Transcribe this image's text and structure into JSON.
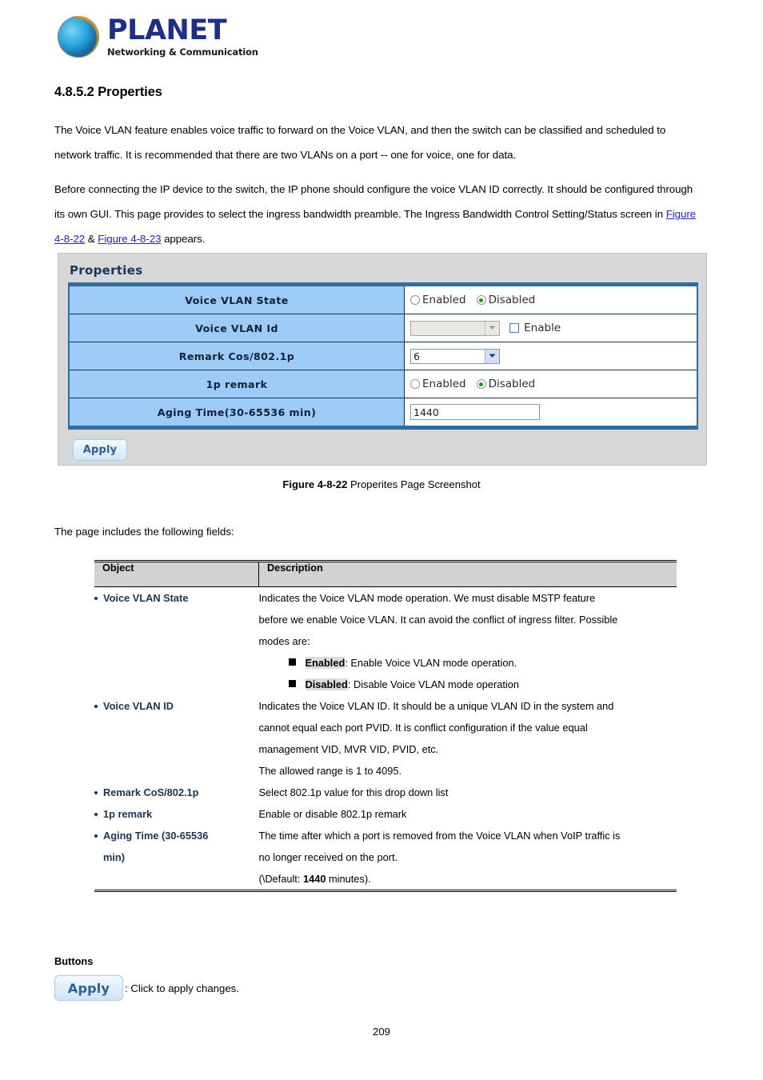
{
  "brand": {
    "name": "PLANET",
    "tagline": "Networking & Communication",
    "logo_icon": "globe-icon"
  },
  "document": {
    "section_number": "4.8.5.2",
    "section_title": "4.8.5.2 Properties",
    "paragraph_1": "The Voice VLAN feature enables voice traffic to forward on the Voice VLAN, and then the switch can be classified and scheduled to network traffic. It is recommended that there are two VLANs on a port -- one for voice, one for data.",
    "paragraph_2_part_1": "Before connecting the IP device to the switch, the IP phone should configure the voice VLAN ID correctly. It should be configured through its own GUI. This page provides to select the ingress bandwidth preamble. The Ingress Bandwidth Control Setting/Status screen in ",
    "link_1": "Figure 4-8-22",
    "paragraph_2_amp": " & ",
    "link_2": "Figure 4-8-23",
    "paragraph_2_part_2": " appears.",
    "figure_caption_bold": "Figure 4-8-22",
    "figure_caption_rest": " Properites Page Screenshot",
    "fields_intro": "The page includes the following fields:",
    "page_number": "209",
    "link_color": "#2222dd"
  },
  "screenshot": {
    "title": "Properties",
    "rows": [
      {
        "label": "Voice VLAN State",
        "control": "radio",
        "options": [
          "Enabled",
          "Disabled"
        ],
        "selected": "Disabled"
      },
      {
        "label": "Voice VLAN Id",
        "control": "select-disabled-with-checkbox",
        "select_value": "",
        "checkbox_label": "Enable",
        "checkbox_checked": false
      },
      {
        "label": "Remark Cos/802.1p",
        "control": "select",
        "select_value": "6"
      },
      {
        "label": "1p remark",
        "control": "radio",
        "options": [
          "Enabled",
          "Disabled"
        ],
        "selected": "Disabled"
      },
      {
        "label": "Aging Time(30-65536 min)",
        "control": "text",
        "value": "1440"
      }
    ],
    "apply_label": "Apply",
    "colors": {
      "panel_bg": "#d7d7d7",
      "label_cell": "#9ccbf5",
      "table_border": "#2e6da4",
      "title_text": "#17365d"
    }
  },
  "desc_table": {
    "headers": [
      "Object",
      "Description"
    ],
    "rows": [
      {
        "object": [
          "Voice VLAN State"
        ],
        "lines": [
          "Indicates the Voice VLAN mode operation. We must disable MSTP feature",
          "before we enable Voice VLAN. It can avoid the conflict of ingress filter. Possible",
          "modes are:"
        ],
        "bullets": [
          {
            "term": "Enabled",
            "text": ": Enable Voice VLAN mode operation."
          },
          {
            "term": "Disabled",
            "text": ": Disable Voice VLAN mode operation"
          }
        ]
      },
      {
        "object": [
          "Voice VLAN ID"
        ],
        "lines": [
          "Indicates the Voice VLAN ID. It should be a unique VLAN ID in the system and",
          "cannot equal each port PVID. It is conflict configuration if the value equal",
          "management VID, MVR VID, PVID, etc.",
          "The allowed range is 1 to 4095."
        ],
        "bullets": []
      },
      {
        "object": [
          "Remark CoS/802.1p"
        ],
        "lines": [
          "Select 802.1p value for this drop down list"
        ],
        "bullets": []
      },
      {
        "object": [
          "1p remark"
        ],
        "lines": [
          "Enable or disable 802.1p remark"
        ],
        "bullets": []
      },
      {
        "object": [
          "Aging Time (30-65536",
          "min)"
        ],
        "lines": [
          "The time after which a port is removed from the Voice VLAN when VoIP traffic is",
          "no longer received on the port."
        ],
        "default_line": {
          "pre": "(\\Default: ",
          "value": "1440",
          "post": " minutes)."
        },
        "bullets": []
      }
    ]
  },
  "buttons_section": {
    "heading": "Buttons",
    "apply_label": "Apply",
    "apply_caption": ": Click to apply changes."
  }
}
